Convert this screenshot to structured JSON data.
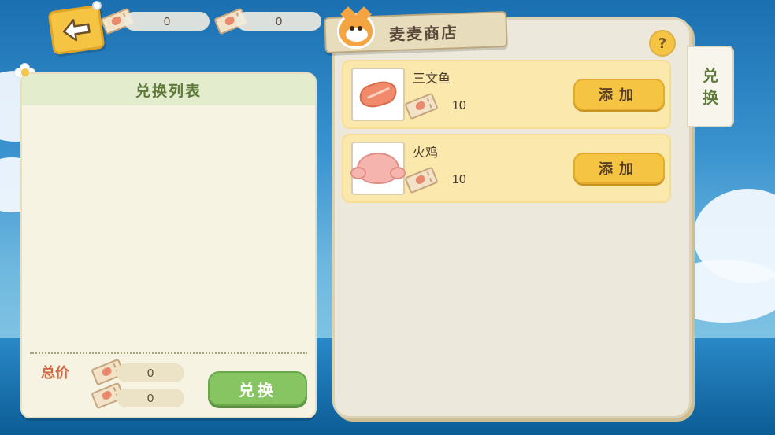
{
  "top_bar": {
    "currency_1": "0",
    "currency_2": "0"
  },
  "left_panel": {
    "title": "兑换列表",
    "total_label": "总价",
    "total_1": "0",
    "total_2": "0",
    "exchange_label": "兑换"
  },
  "shop": {
    "title": "麦麦商店",
    "help_label": "?",
    "side_tab_line1": "兑",
    "side_tab_line2": "换",
    "items": [
      {
        "name": "三文鱼",
        "price": "10",
        "add_label": "添加",
        "icon": "salmon-icon"
      },
      {
        "name": "火鸡",
        "price": "10",
        "add_label": "添加",
        "icon": "turkey-icon"
      }
    ]
  },
  "colors": {
    "accent_yellow": "#f5c443",
    "green_button": "#86c561",
    "card_bg": "#fbe8ad",
    "panel_bg": "#f7f3e3"
  }
}
